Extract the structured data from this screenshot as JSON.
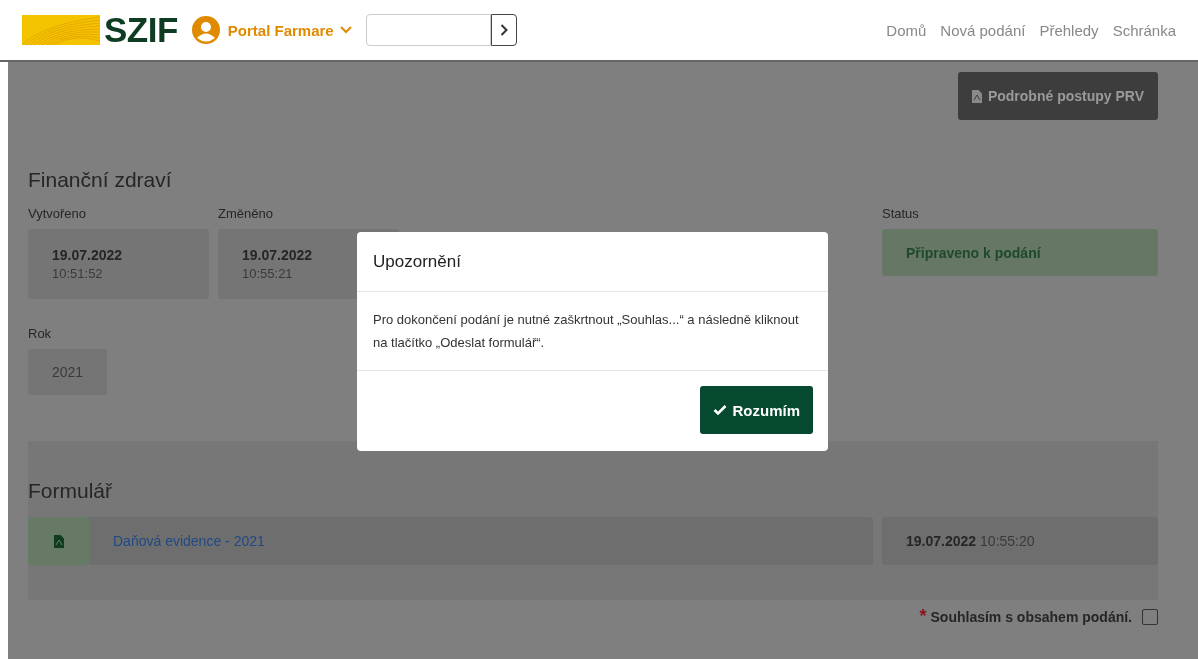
{
  "header": {
    "logo": "SZIF",
    "portal": "Portal Farmare",
    "nav": [
      {
        "label": "Domů"
      },
      {
        "label": "Nová podání"
      },
      {
        "label": "Přehledy"
      },
      {
        "label": "Schránka"
      }
    ]
  },
  "toolbar_button": "Podrobné postupy PRV",
  "title": "Finanční zdraví",
  "fields": [
    {
      "label": "Vytvořeno",
      "date": "19.07.2022",
      "time": "10:51:52"
    },
    {
      "label": "Změněno",
      "date": "19.07.2022",
      "time": "10:55:21"
    }
  ],
  "status": {
    "label": "Status",
    "value": "Připraveno k podání"
  },
  "year": {
    "label": "Rok",
    "value": "2021"
  },
  "form": {
    "title": "Formulář",
    "document": "Daňová evidence - 2021",
    "date": "19.07.2022",
    "time": "10:55:20"
  },
  "consent": {
    "required_mark": "*",
    "label": "Souhlasím s obsahem podání.",
    "checked": false
  },
  "modal": {
    "title": "Upozornění",
    "message": "Pro dokončení podání je nutné zaškrtnout „Souhlas...“ a následně kliknout na tlačítko „Odeslat formulář“.",
    "button": "Rozumím"
  }
}
